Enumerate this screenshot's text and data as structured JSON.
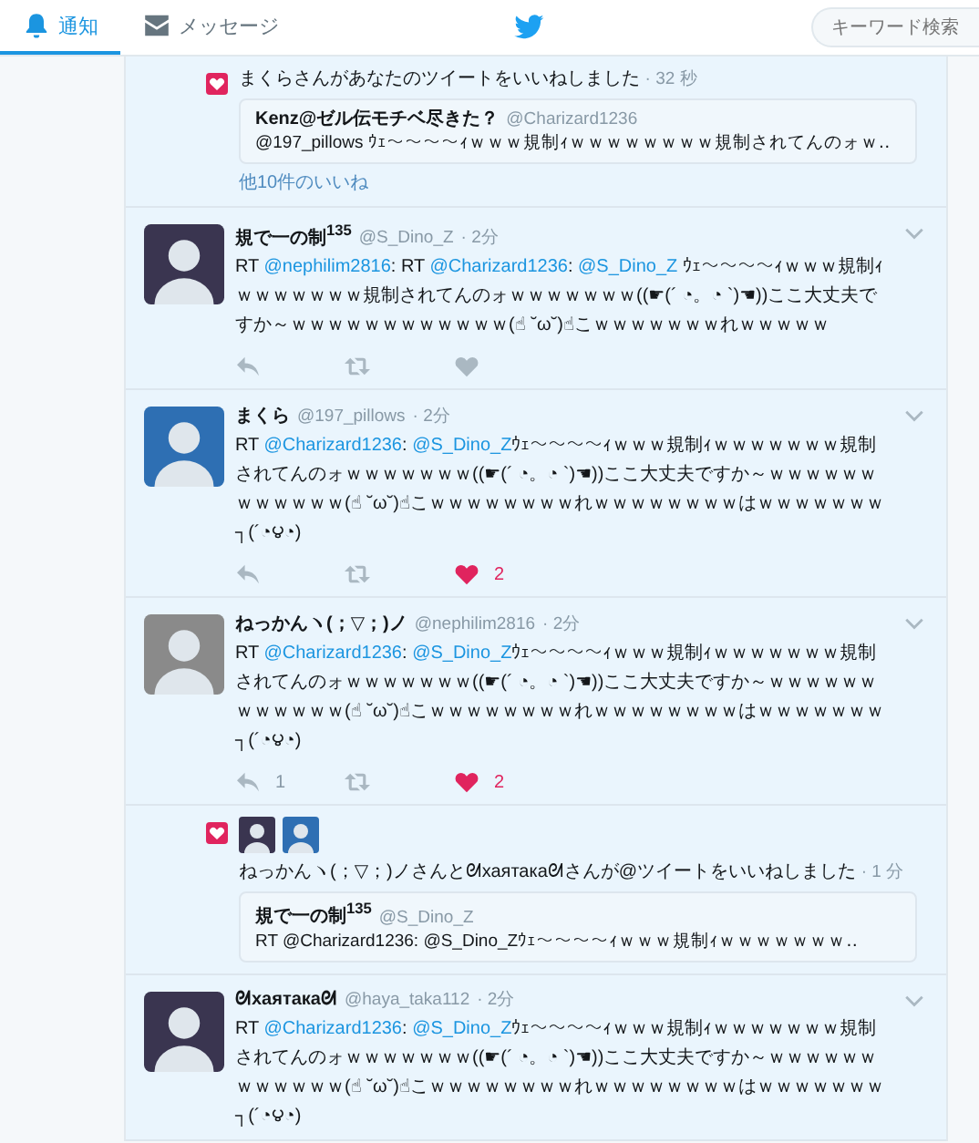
{
  "header": {
    "tabs": [
      {
        "label": "通知",
        "selected": true
      },
      {
        "label": "メッセージ",
        "selected": false
      }
    ],
    "search": {
      "placeholder": "キーワード検索"
    }
  },
  "stream": [
    {
      "kind": "like_notification",
      "text": "まくらさんがあなたのツイートをいいねしました",
      "time": "· 32 秒",
      "quoted": {
        "name": "Kenz@ゼル伝モチベ尽きた？",
        "handle": "@Charizard1236",
        "text": "@197_pillows ｳｪ～～～～ｨｗｗｗ規制ｨｗｗｗｗｗｗｗｗ規制されてんのォｗ‥"
      },
      "more": "他10件のいいね"
    },
    {
      "kind": "tweet",
      "name": "規で一の制$^{135}$",
      "handle": "@S_Dino_Z",
      "time": "· 2分",
      "segments": [
        {
          "kind": "plain",
          "text": "RT "
        },
        {
          "kind": "mention",
          "text": "@nephilim2816"
        },
        {
          "kind": "plain",
          "text": ": RT "
        },
        {
          "kind": "mention",
          "text": "@Charizard1236"
        },
        {
          "kind": "plain",
          "text": ": "
        },
        {
          "kind": "mention",
          "text": "@S_Dino_Z"
        },
        {
          "kind": "plain",
          "text": " ｳｪ～～～～ｨｗｗｗ規制ｨｗｗｗｗｗｗｗ規制されてんのォｗｗｗｗｗｗｗ((☛(´ ◔。◔ `)☚))ここ大丈夫ですか～ｗｗｗｗｗｗｗｗｗｗｗｗ(☝ ˘ω˘)☝こｗｗｗｗｗｗｗれｗｗｗｗｗ"
        }
      ],
      "actions": {
        "liked": false
      }
    },
    {
      "kind": "tweet",
      "name": "まくら",
      "handle": "@197_pillows",
      "time": "· 2分",
      "segments": [
        {
          "kind": "plain",
          "text": "RT "
        },
        {
          "kind": "mention",
          "text": "@Charizard1236"
        },
        {
          "kind": "plain",
          "text": ": "
        },
        {
          "kind": "mention",
          "text": "@S_Dino_Z"
        },
        {
          "kind": "plain",
          "text": "ｳｪ～～～～ｨｗｗｗ規制ｨｗｗｗｗｗｗｗ規制されてんのォｗｗｗｗｗｗｗ((☛(´ ◔。◔ `)☚))ここ大丈夫ですか～ｗｗｗｗｗｗｗｗｗｗｗｗ(☝ ˘ω˘)☝こｗｗｗｗｗｗｗｗれｗｗｗｗｗｗｗｗはｗｗｗｗｗｗｗ┐(´◔౪◔)"
        }
      ],
      "actions": {
        "liked": true,
        "likes": "2"
      }
    },
    {
      "kind": "tweet",
      "name": "ねっかんヽ(；▽；)ノ",
      "handle": "@nephilim2816",
      "time": "· 2分",
      "segments": [
        {
          "kind": "plain",
          "text": "RT "
        },
        {
          "kind": "mention",
          "text": "@Charizard1236"
        },
        {
          "kind": "plain",
          "text": ": "
        },
        {
          "kind": "mention",
          "text": "@S_Dino_Z"
        },
        {
          "kind": "plain",
          "text": "ｳｪ～～～～ｨｗｗｗ規制ｨｗｗｗｗｗｗｗ規制されてんのォｗｗｗｗｗｗｗ((☛(´ ◔。◔ `)☚))ここ大丈夫ですか～ｗｗｗｗｗｗｗｗｗｗｗｗ(☝ ˘ω˘)☝こｗｗｗｗｗｗｗｗれｗｗｗｗｗｗｗｗはｗｗｗｗｗｗｗ┐(´◔౪◔)"
        }
      ],
      "actions": {
        "replies": "1",
        "liked": true,
        "likes": "2"
      }
    },
    {
      "kind": "like_notification",
      "text": "ねっかんヽ(；▽；)ノさんとᘛхаятакаᘛさんが@ツイートをいいねしました",
      "time": "· 1 分",
      "quoted": {
        "name": "規で一の制$^{135}$",
        "handle": "@S_Dino_Z",
        "text": "RT @Charizard1236: @S_Dino_Zｳｪ～～～～ｨｗｗｗ規制ｨｗｗｗｗｗｗｗ‥"
      }
    },
    {
      "kind": "tweet",
      "name": "ᘛхаятакаᘛ",
      "handle": "@haya_taka112",
      "time": "· 2分",
      "segments": [
        {
          "kind": "plain",
          "text": "RT "
        },
        {
          "kind": "mention",
          "text": "@Charizard1236"
        },
        {
          "kind": "plain",
          "text": ": "
        },
        {
          "kind": "mention",
          "text": "@S_Dino_Z"
        },
        {
          "kind": "plain",
          "text": "ｳｪ～～～～ｨｗｗｗ規制ｨｗｗｗｗｗｗｗ規制されてんのォｗｗｗｗｗｗｗ((☛(´ ◔。◔ `)☚))ここ大丈夫ですか～ｗｗｗｗｗｗｗｗｗｗｗｗ(☝ ˘ω˘)☝こｗｗｗｗｗｗｗｗれｗｗｗｗｗｗｗｗはｗｗｗｗｗｗｗ┐(´◔౪◔)"
        }
      ]
    }
  ]
}
